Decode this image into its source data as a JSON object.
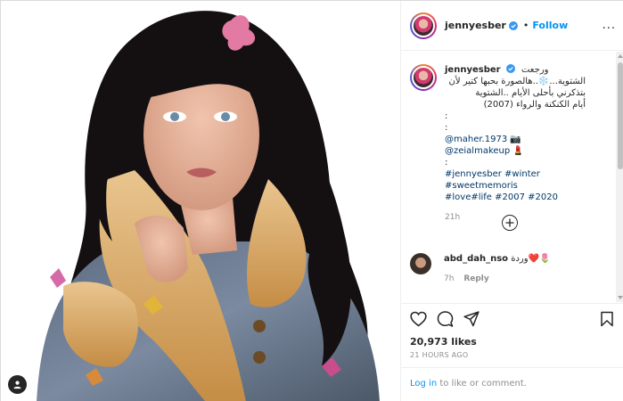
{
  "post": {
    "username": "jennyesber",
    "dot": "•",
    "follow_label": "Follow",
    "more_label": "...",
    "caption": {
      "username": "jennyesber",
      "arabic_lines": [
        "ورجعت",
        "الشتوية...❄️..هالصورة بحبها كتير لأن",
        "بتذكرني بأحلى الأيام ..الشتوية",
        "أيام الكنكنة والرواء (2007)"
      ],
      "separator_1": ":",
      "separator_2": ":",
      "credit_1": "@maher.1973 📷",
      "credit_2": "@zeialmakeup 💄",
      "separator_3": ":",
      "hashtags_line_1": "#jennyesber #winter #sweetmemoris",
      "hashtags_line_2": "#love#life #2007 #2020",
      "time": "21h"
    },
    "comment": {
      "username": "abd_dah_nso",
      "text": "وردة❤️🌷",
      "time": "7h",
      "reply_label": "Reply"
    },
    "likes": "20,973 likes",
    "posted_ago": "21 HOURS AGO",
    "login": {
      "link_label": "Log in",
      "rest": " to like or comment."
    },
    "colors": {
      "accent": "#0095f6",
      "link": "#00376b",
      "muted": "#8e8e8e",
      "text": "#262626"
    }
  }
}
